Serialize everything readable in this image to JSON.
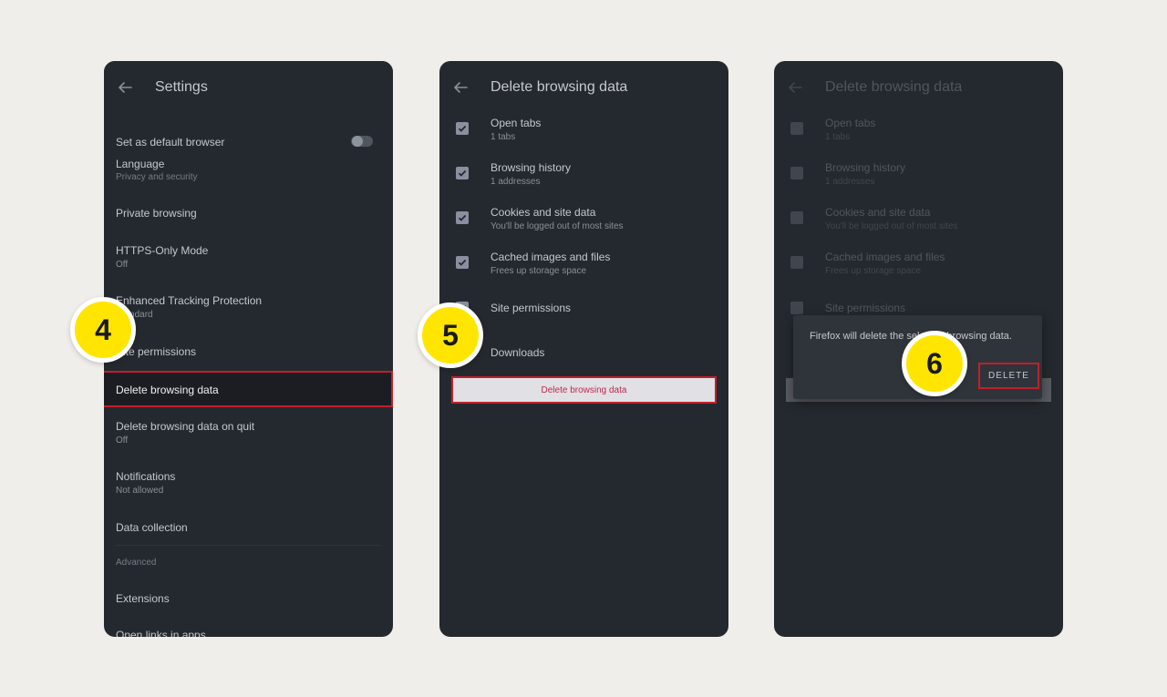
{
  "step_badges": [
    "4",
    "5",
    "6"
  ],
  "screen1": {
    "title": "Settings",
    "cut_top_label": "Language",
    "default_browser_label": "Set as default browser",
    "default_browser_enabled": false,
    "category_privacy": "Privacy and security",
    "items": [
      {
        "label": "Private browsing",
        "sub": ""
      },
      {
        "label": "HTTPS-Only Mode",
        "sub": "Off"
      },
      {
        "label": "Enhanced Tracking Protection",
        "sub": "Standard"
      },
      {
        "label": "Site permissions",
        "sub": ""
      }
    ],
    "highlighted_item": "Delete browsing data",
    "items_after": [
      {
        "label": "Delete browsing data on quit",
        "sub": "Off"
      },
      {
        "label": "Notifications",
        "sub": "Not allowed"
      },
      {
        "label": "Data collection",
        "sub": ""
      }
    ],
    "category_advanced": "Advanced",
    "extensions_label": "Extensions",
    "cut_bottom_label": "Open links in apps"
  },
  "screen2": {
    "title": "Delete browsing data",
    "options": [
      {
        "label": "Open tabs",
        "sub": "1 tabs",
        "checked": true
      },
      {
        "label": "Browsing history",
        "sub": "1 addresses",
        "checked": true
      },
      {
        "label": "Cookies and site data",
        "sub": "You'll be logged out of most sites",
        "checked": true
      },
      {
        "label": "Cached images and files",
        "sub": "Frees up storage space",
        "checked": true
      },
      {
        "label": "Site permissions",
        "sub": "",
        "checked": true
      },
      {
        "label": "Downloads",
        "sub": "",
        "checked": true
      }
    ],
    "delete_button_label": "Delete browsing data"
  },
  "screen3": {
    "title": "Delete browsing data",
    "dialog_message": "Firefox will delete the selected browsing data.",
    "dialog_confirm_label": "DELETE"
  },
  "colors": {
    "phone_bg": "#24292f",
    "highlight_border": "#c21f2b",
    "badge_yellow": "#ffe500",
    "delete_text": "#bf2a4a"
  }
}
